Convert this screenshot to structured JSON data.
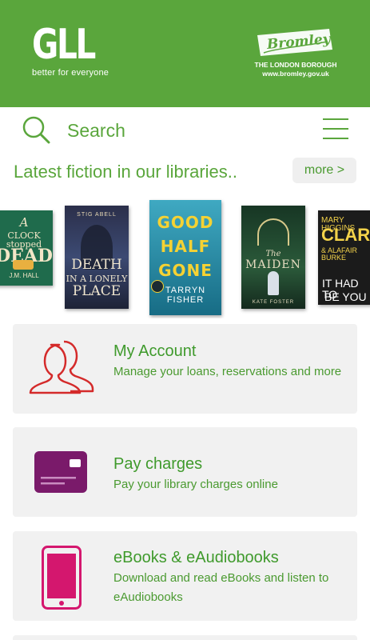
{
  "header": {
    "gll_logo": "GLL",
    "gll_tagline": "better for everyone",
    "council_name": "Bromley",
    "council_line1": "THE LONDON BOROUGH",
    "council_line2": "www.bromley.gov.uk",
    "background_color": "#5aa63c"
  },
  "search": {
    "label": "Search",
    "icon": "search-icon"
  },
  "menu": {
    "icon": "hamburger-menu-icon"
  },
  "fiction": {
    "title": "Latest fiction in our libraries..",
    "more_label": "more >",
    "books": [
      {
        "cover_lines": [
          "A",
          "CLOCK stopped",
          "DEAD",
          "J.M. HALL"
        ]
      },
      {
        "cover_lines": [
          "STIG ABELL",
          "DEATH",
          "IN A LONELY",
          "PLACE"
        ]
      },
      {
        "cover_lines": [
          "GOOD",
          "HALF",
          "GONE",
          "TARRYN",
          "FISHER"
        ]
      },
      {
        "cover_lines": [
          "The",
          "MAIDEN",
          "KATE FOSTER"
        ]
      },
      {
        "cover_lines": [
          "MARY HIGGINS",
          "CLARK",
          "& ALAFAIR BURKE",
          "IT HAD TO",
          "BE YOU"
        ]
      }
    ]
  },
  "cards": [
    {
      "title": "My Account",
      "description": "Manage your loans, reservations and more",
      "icon": "users-icon",
      "icon_color": "#d42a2a"
    },
    {
      "title": "Pay charges",
      "description": "Pay your library charges online",
      "icon": "credit-card-icon",
      "icon_color": "#7a1a6a"
    },
    {
      "title": "eBooks & eAudiobooks",
      "description": "Download and read eBooks and listen to eAudiobooks",
      "icon": "tablet-icon",
      "icon_color": "#d4176e"
    }
  ]
}
